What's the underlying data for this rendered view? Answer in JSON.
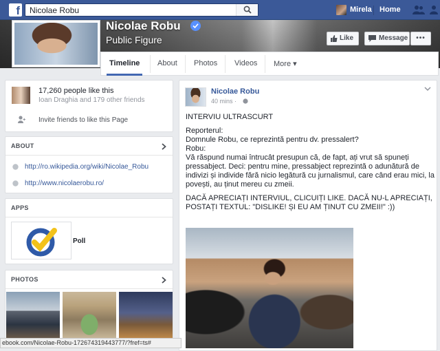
{
  "topbar": {
    "logo": "f",
    "search_value": "Nicolae Robu",
    "user_name": "Mirela",
    "home_label": "Home",
    "icons": [
      "search-icon",
      "friends-icon",
      "people-icon"
    ]
  },
  "page": {
    "name": "Nicolae Robu",
    "category": "Public Figure",
    "like_label": "Like",
    "message_label": "Message",
    "more_label": "•••"
  },
  "tabs": [
    {
      "label": "Timeline",
      "active": true
    },
    {
      "label": "About"
    },
    {
      "label": "Photos"
    },
    {
      "label": "Videos"
    },
    {
      "label": "More ▾"
    }
  ],
  "likes": {
    "count_text": "17,260 people like this",
    "friends_text": "Ioan Draghia and 179 other friends",
    "invite_text": "Invite friends to like this Page"
  },
  "about": {
    "title": "ABOUT",
    "links": [
      "http://ro.wikipedia.org/wiki/Nicolae_Robu",
      "http://www.nicolaerobu.ro/"
    ]
  },
  "apps": {
    "title": "APPS",
    "items": [
      {
        "label": "Poll"
      }
    ]
  },
  "photos": {
    "title": "PHOTOS"
  },
  "post": {
    "author": "Nicolae Robu",
    "time": "40 mins ·",
    "lines": [
      "INTERVIU ULTRASCURT",
      "Reporterul:",
      "Domnule Robu, ce reprezintă pentru dv. pressalert?",
      "Robu:",
      "Vă răspund numai întrucât presupun că, de fapt, ați vrut să spuneți pressabject. Deci: pentru mine, pressabject reprezintă o adunătură de indivizi și individe fără nicio legătură cu jurnalismul, care când erau mici, la povești, au ținut mereu cu zmeii.",
      "DACĂ APRECIAȚI INTERVIUL, CLICUIȚI LIKE. DACĂ NU-L APRECIAȚI, POSTAȚI TEXTUL: \"DISLIKE! ȘI EU AM ȚINUT CU ZMEII!\" :))"
    ]
  },
  "statusbar": {
    "url": "ebook.com/Nicolae-Robu-172674319443777/?fref=ts#"
  },
  "colors": {
    "brand": "#3b5998",
    "link": "#365899",
    "background": "#e9ebee"
  }
}
